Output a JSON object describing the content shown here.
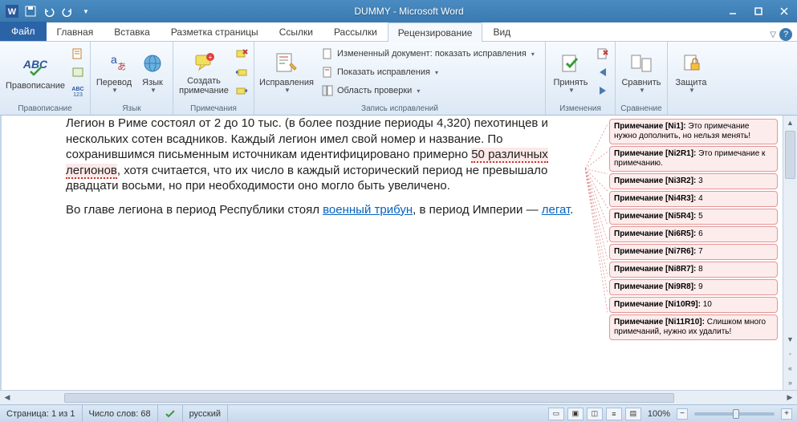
{
  "title": "DUMMY - Microsoft Word",
  "tabs": {
    "file": "Файл",
    "items": [
      "Главная",
      "Вставка",
      "Разметка страницы",
      "Ссылки",
      "Рассылки",
      "Рецензирование",
      "Вид"
    ],
    "active": 5
  },
  "ribbon": {
    "g_spell": {
      "label": "Правописание",
      "btn": "Правописание"
    },
    "g_lang": {
      "label": "Язык",
      "translate": "Перевод",
      "language": "Язык"
    },
    "g_notes": {
      "label": "Примечания",
      "new": "Создать\nпримечание"
    },
    "g_track": {
      "label": "Запись исправлений",
      "btn": "Исправления",
      "row1": "Измененный документ: показать исправления",
      "row2": "Показать исправления",
      "row3": "Область проверки"
    },
    "g_changes": {
      "label": "Изменения",
      "accept": "Принять"
    },
    "g_compare": {
      "label": "Сравнение",
      "btn": "Сравнить"
    },
    "g_protect": {
      "label": "",
      "btn": "Защита"
    }
  },
  "document": {
    "p1_a": "Легион в Риме состоял от 2 до 10 тыс. (в более поздние периоды 4,320) пехотинцев и нескольких сотен всадников. Каждый легион имел свой номер и название. По сохранившимся письменным источникам идентифицировано примерно ",
    "p1_mark": "50 различных легионов",
    "p1_b": ", хотя считается, что их число в каждый исторический период не превышало двадцати восьми, но при необходимости оно могло быть увеличено.",
    "p2_a": "Во главе легиона в период Республики стоял ",
    "p2_link1": "военный трибун",
    "p2_b": ", в период Империи — ",
    "p2_link2": "легат",
    "p2_c": "."
  },
  "comments": [
    {
      "tag": "[Ni1]",
      "text": "Это примечание нужно дополнить, но нельзя менять!"
    },
    {
      "tag": "[Ni2R1]",
      "text": "Это примечание к примечанию."
    },
    {
      "tag": "[Ni3R2]",
      "text": "3"
    },
    {
      "tag": "[Ni4R3]",
      "text": "4"
    },
    {
      "tag": "[Ni5R4]",
      "text": "5"
    },
    {
      "tag": "[Ni6R5]",
      "text": "6"
    },
    {
      "tag": "[Ni7R6]",
      "text": "7"
    },
    {
      "tag": "[Ni8R7]",
      "text": "8"
    },
    {
      "tag": "[Ni9R8]",
      "text": "9"
    },
    {
      "tag": "[Ni10R9]",
      "text": "10"
    },
    {
      "tag": "[Ni11R10]",
      "text": "Слишком много примечаний, нужно их удалить!"
    }
  ],
  "comment_label": "Примечание",
  "status": {
    "page": "Страница: 1 из 1",
    "words": "Число слов: 68",
    "lang": "русский",
    "zoom": "100%"
  }
}
